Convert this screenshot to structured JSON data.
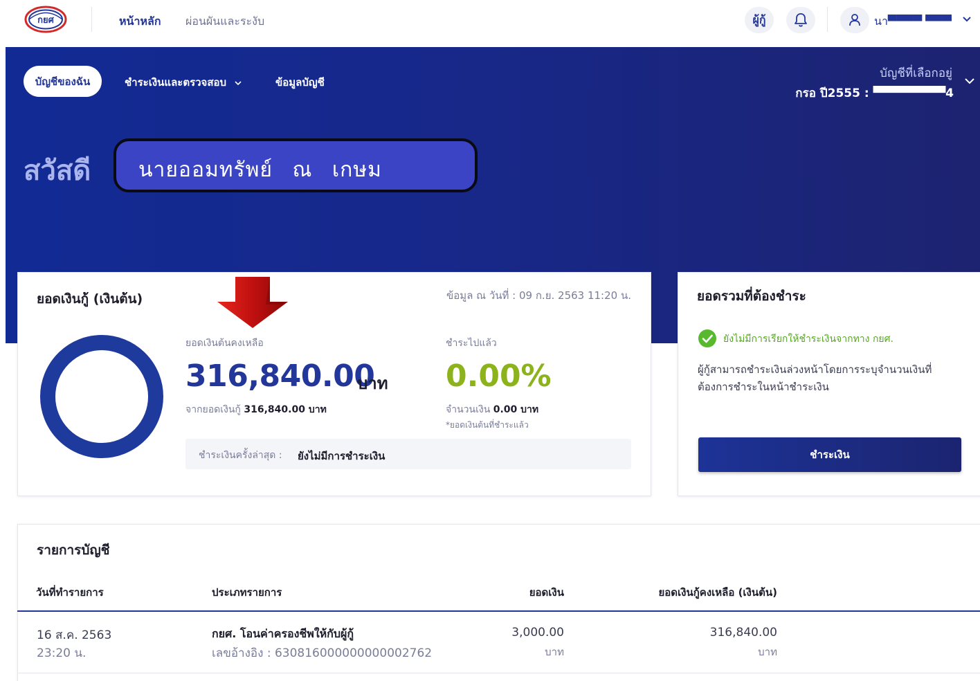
{
  "colors": {
    "brand": "#23379b",
    "hero": "#17288a",
    "success": "#58a626",
    "percent": "#8cb31c",
    "arrow": "#d11a12"
  },
  "logo": {
    "icon": "kyor-sor-or-logo",
    "text": "กยศ"
  },
  "nav": {
    "home": "หน้าหลัก",
    "plan": "ผ่อนผันและระงับ"
  },
  "header": {
    "borrower_label": "ผู้กู้",
    "bell_icon": "bell-icon",
    "user_icon": "user-icon",
    "user_name": "นา▀▀▀▀ ▀▀▀▀▀ง"
  },
  "tabs": {
    "my_account": "บัญชีของฉัน",
    "payment": "ชำระเงินและตรวจสอบ",
    "account_info": "ข้อมูลบัญชี"
  },
  "account": {
    "selected_label": "บัญชีที่เลือกอยู่",
    "number": "กรอ ปี2555 : ▀▀▀▀▀▀▀▀4"
  },
  "greeting": {
    "hello": "สวัสดี",
    "name": "นายออมทรัพย์ ณ เกษม"
  },
  "loan": {
    "title": "ยอดเงินกู้ (เงินต้น)",
    "as_of": "ข้อมูล ณ วันที่ : 09 ก.ย. 2563 11:20 น.",
    "remaining_label": "ยอดเงินต้นคงเหลือ",
    "remaining_amount": "316,840.00",
    "unit": "บาท",
    "from_label": "จากยอดเงินกู้",
    "from_amount": "316,840.00 บาท",
    "paid_label": "ชำระไปแล้ว",
    "paid_percent": "0.00%",
    "paid_amount_label": "จำนวนเงิน",
    "paid_amount": "0.00 บาท",
    "paid_note": "*ยอดเงินต้นที่ชำระแล้ว",
    "last_payment_label": "ชำระเงินครั้งล่าสุด :",
    "last_payment_value": "ยังไม่มีการชำระเงิน",
    "paid_fraction": 0
  },
  "due": {
    "title": "ยอดรวมที่ต้องชำระ",
    "status": "ยังไม่มีการเรียกให้ชำระเงินจากทาง กยศ.",
    "description": "ผู้กู้สามารถชำระเงินล่วงหน้าโดยการระบุจำนวนเงินที่ต้องการชำระในหน้าชำระเงิน",
    "pay_button": "ชำระเงิน"
  },
  "transactions": {
    "title": "รายการบัญชี",
    "headers": {
      "date": "วันที่ทำรายการ",
      "type": "ประเภทรายการ",
      "amount": "ยอดเงิน",
      "balance": "ยอดเงินกู้คงเหลือ (เงินต้น)"
    },
    "rows": [
      {
        "date": "16 ส.ค. 2563",
        "time": "23:20 น.",
        "type": "กยศ. โอนค่าครองชีพให้กับผู้กู้",
        "ref": "เลขอ้างอิง : 630816000000000002762",
        "amount": "3,000.00",
        "amount_unit": "บาท",
        "balance": "316,840.00",
        "balance_unit": "บาท"
      }
    ]
  }
}
